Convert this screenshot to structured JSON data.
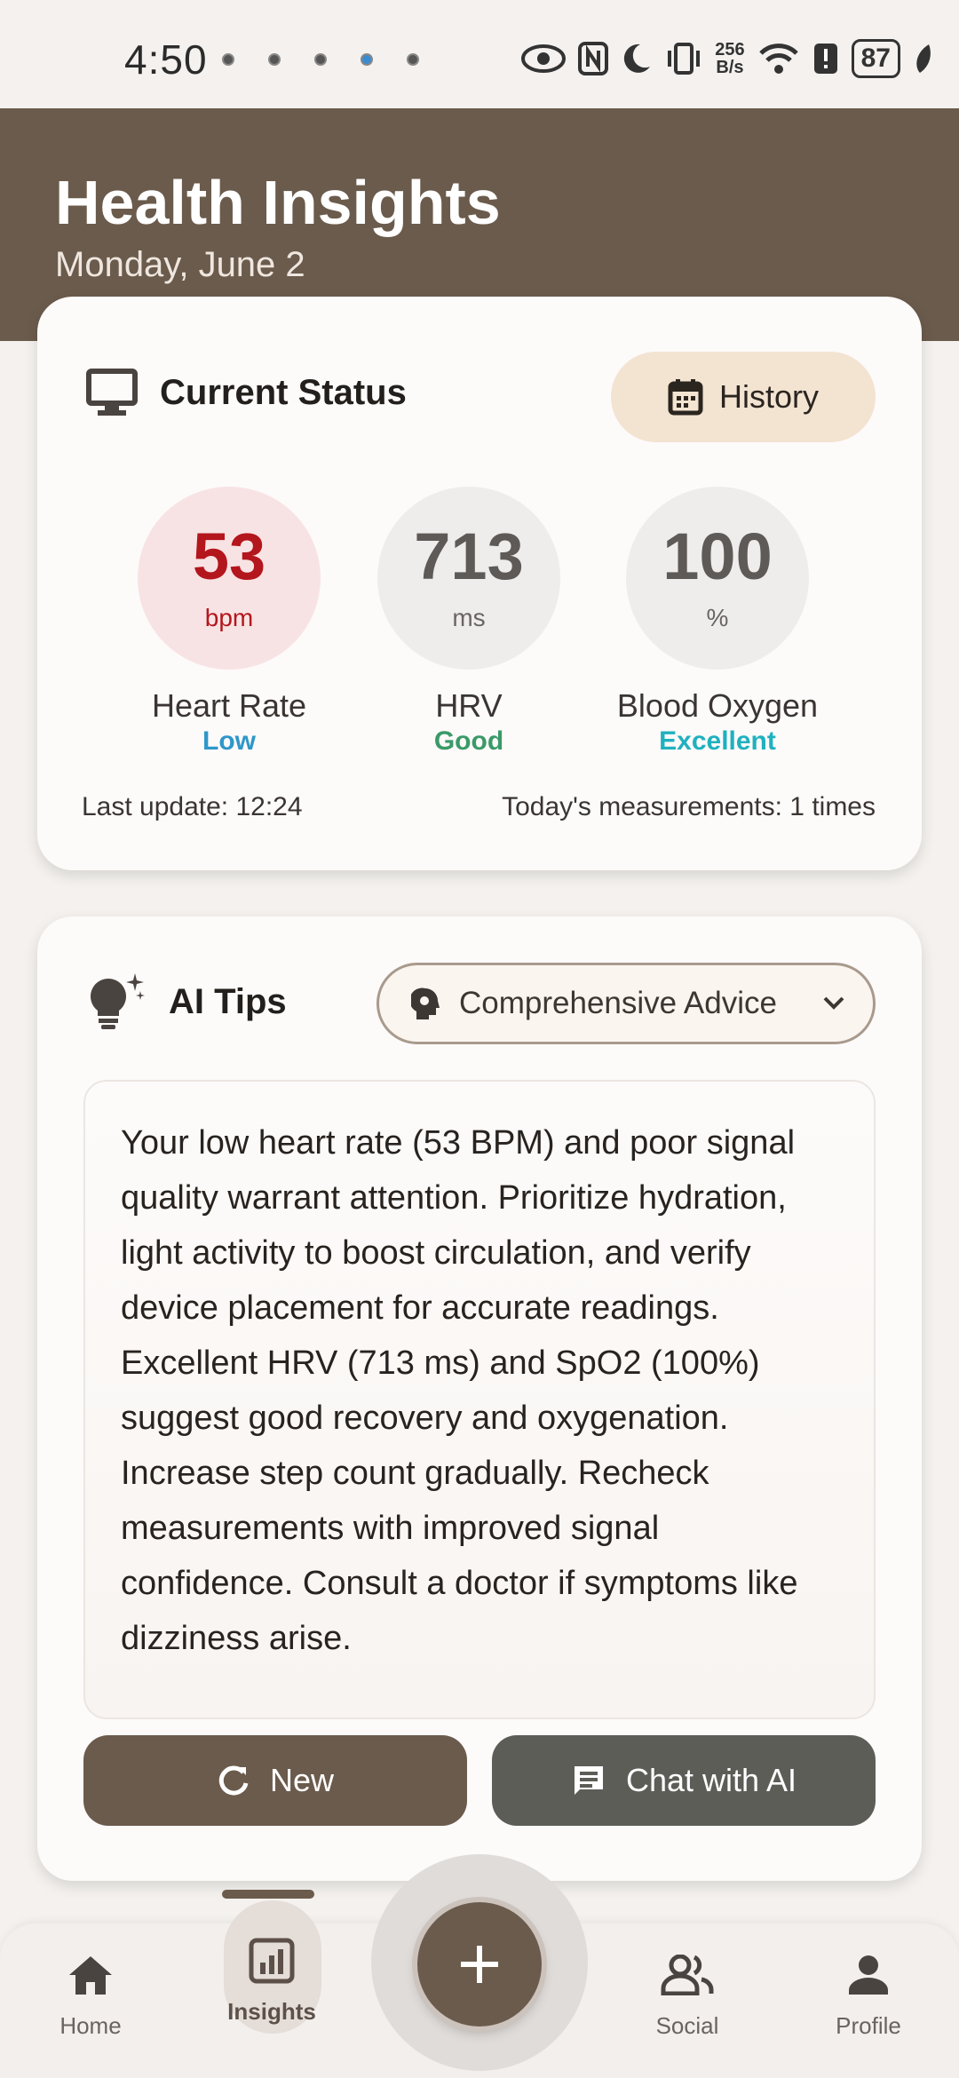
{
  "status_bar": {
    "time": "4:50",
    "network_speed_top": "256",
    "network_speed_bottom": "B/s",
    "battery": "87"
  },
  "header": {
    "title": "Health Insights",
    "date": "Monday, June 2"
  },
  "current_status": {
    "title": "Current Status",
    "history_label": "History",
    "metrics": [
      {
        "value": "53",
        "unit": "bpm",
        "label": "Heart Rate",
        "state": "Low",
        "state_color": "#2f97c9"
      },
      {
        "value": "713",
        "unit": "ms",
        "label": "HRV",
        "state": "Good",
        "state_color": "#3a9a68"
      },
      {
        "value": "100",
        "unit": "%",
        "label": "Blood Oxygen",
        "state": "Excellent",
        "state_color": "#1fb1bf"
      }
    ],
    "last_update": "Last update: 12:24",
    "measurements": "Today's measurements: 1 times"
  },
  "ai_tips": {
    "title": "AI Tips",
    "advice_select": "Comprehensive Advice",
    "advice_text": "Your low heart rate (53 BPM) and poor signal quality warrant attention. Prioritize hydration, light activity to boost circulation, and verify device placement for accurate readings. Excellent HRV (713 ms) and SpO2 (100%) suggest good recovery and oxygenation. Increase step count gradually. Recheck measurements with improved signal confidence. Consult a doctor if symptoms like dizziness arise.",
    "new_label": "New",
    "chat_label": "Chat with AI"
  },
  "nav": {
    "home": "Home",
    "insights": "Insights",
    "social": "Social",
    "profile": "Profile"
  },
  "colors": {
    "brand": "#6b5b4c",
    "heart_rate": "#b3161c"
  }
}
